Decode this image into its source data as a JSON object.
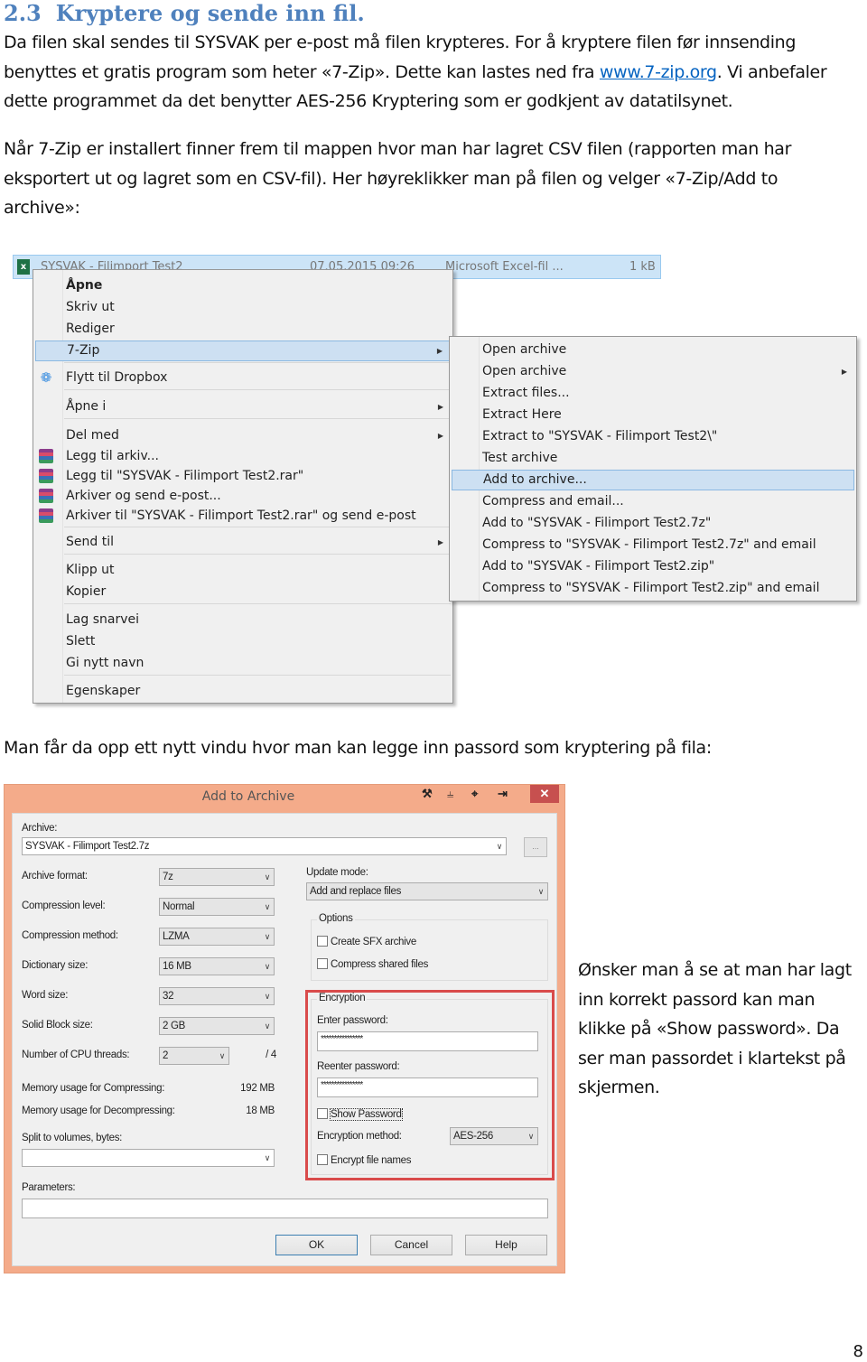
{
  "section": {
    "number": "2.3",
    "title": "Kryptere og sende inn fil."
  },
  "intro": {
    "text_before_link": "Da filen skal sendes til SYSVAK per e-post må filen krypteres. For å kryptere filen før innsending benyttes et gratis program som heter «7-Zip». Dette kan lastes ned fra ",
    "link": "www.7-zip.org",
    "text_after_link": ". Vi anbefaler dette programmet da det benytter AES-256 Kryptering som er godkjent av datatilsynet."
  },
  "instructions": "Når 7-Zip er installert finner frem til mappen hvor man har lagret CSV filen (rapporten man har eksportert ut og lagret som en CSV-fil). Her høyreklikker man på filen og velger «7-Zip/Add to archive»:",
  "file_row": {
    "icon": "excel-icon",
    "name": "SYSVAK - Filimport Test2",
    "date": "07.05.2015 09:26",
    "type": "Microsoft Excel-fil ...",
    "size": "1 kB"
  },
  "context_menu": {
    "items": [
      {
        "label": "Åpne",
        "bold": true
      },
      {
        "label": "Skriv ut"
      },
      {
        "label": "Rediger"
      },
      {
        "label": "7-Zip",
        "submenu": true,
        "highlighted": true
      },
      {
        "label": "Flytt til Dropbox",
        "icon": "dropbox-icon"
      },
      {
        "label": "Åpne i",
        "submenu": true
      },
      {
        "label": "Del med",
        "submenu": true
      },
      {
        "label": "Legg til arkiv...",
        "icon": "winrar-icon"
      },
      {
        "label": "Legg til \"SYSVAK - Filimport Test2.rar\"",
        "icon": "winrar-icon"
      },
      {
        "label": "Arkiver og send e-post...",
        "icon": "winrar-icon"
      },
      {
        "label": "Arkiver til \"SYSVAK - Filimport Test2.rar\" og send e-post",
        "icon": "winrar-icon"
      },
      {
        "label": "Send til",
        "submenu": true
      },
      {
        "label": "Klipp ut"
      },
      {
        "label": "Kopier"
      },
      {
        "label": "Lag snarvei"
      },
      {
        "label": "Slett"
      },
      {
        "label": "Gi nytt navn"
      },
      {
        "label": "Egenskaper"
      }
    ]
  },
  "submenu_7zip": {
    "items": [
      {
        "label": "Open archive"
      },
      {
        "label": "Open archive",
        "submenu": true
      },
      {
        "label": "Extract files..."
      },
      {
        "label": "Extract Here"
      },
      {
        "label": "Extract to \"SYSVAK - Filimport Test2\\\""
      },
      {
        "label": "Test archive"
      },
      {
        "label": "Add to archive...",
        "highlighted": true
      },
      {
        "label": "Compress and email..."
      },
      {
        "label": "Add to \"SYSVAK - Filimport Test2.7z\""
      },
      {
        "label": "Compress to \"SYSVAK - Filimport Test2.7z\" and email"
      },
      {
        "label": "Add to \"SYSVAK - Filimport Test2.zip\""
      },
      {
        "label": "Compress to \"SYSVAK - Filimport Test2.zip\" and email"
      }
    ]
  },
  "dialog_intro": "Man får da opp ett nytt vindu hvor man kan legge inn passord som kryptering på fila:",
  "dialog": {
    "title": "Add to Archive",
    "title_bar_icons": [
      "wrench-icon",
      "pin-icon",
      "target-icon",
      "screen-export-icon"
    ],
    "close": "✕",
    "archive_label": "Archive:",
    "archive_value": "SYSVAK - Filimport Test2.7z",
    "browse_label": "...",
    "archive_format_label": "Archive format:",
    "archive_format": "7z",
    "compression_level_label": "Compression level:",
    "compression_level": "Normal",
    "compression_method_label": "Compression method:",
    "compression_method": "LZMA",
    "dictionary_size_label": "Dictionary size:",
    "dictionary_size": "16 MB",
    "word_size_label": "Word size:",
    "word_size": "32",
    "solid_block_size_label": "Solid Block size:",
    "solid_block_size": "2 GB",
    "cpu_threads_label": "Number of CPU threads:",
    "cpu_threads": "2",
    "cpu_threads_max": "/ 4",
    "mem_compress_label": "Memory usage for Compressing:",
    "mem_compress": "192 MB",
    "mem_decompress_label": "Memory usage for Decompressing:",
    "mem_decompress": "18 MB",
    "split_label": "Split to volumes, bytes:",
    "split_value": "",
    "parameters_label": "Parameters:",
    "parameters_value": "",
    "update_mode_label": "Update mode:",
    "update_mode": "Add and replace files",
    "options_label": "Options",
    "create_sfx_label": "Create SFX archive",
    "create_sfx_checked": false,
    "compress_shared_label": "Compress shared files",
    "compress_shared_checked": false,
    "encryption_label": "Encryption",
    "enter_password_label": "Enter password:",
    "enter_password_value": "****************",
    "reenter_password_label": "Reenter password:",
    "reenter_password_value": "****************",
    "show_password_label": "Show Password",
    "show_password_checked": false,
    "encryption_method_label": "Encryption method:",
    "encryption_method": "AES-256",
    "encrypt_names_label": "Encrypt file names",
    "encrypt_names_checked": false,
    "ok": "OK",
    "cancel": "Cancel",
    "help": "Help"
  },
  "side_note": "Ønsker man å se at man har lagt inn korrekt passord kan man klikke på «Show password». Da ser man passordet i klartekst på skjermen.",
  "page_number": "8"
}
